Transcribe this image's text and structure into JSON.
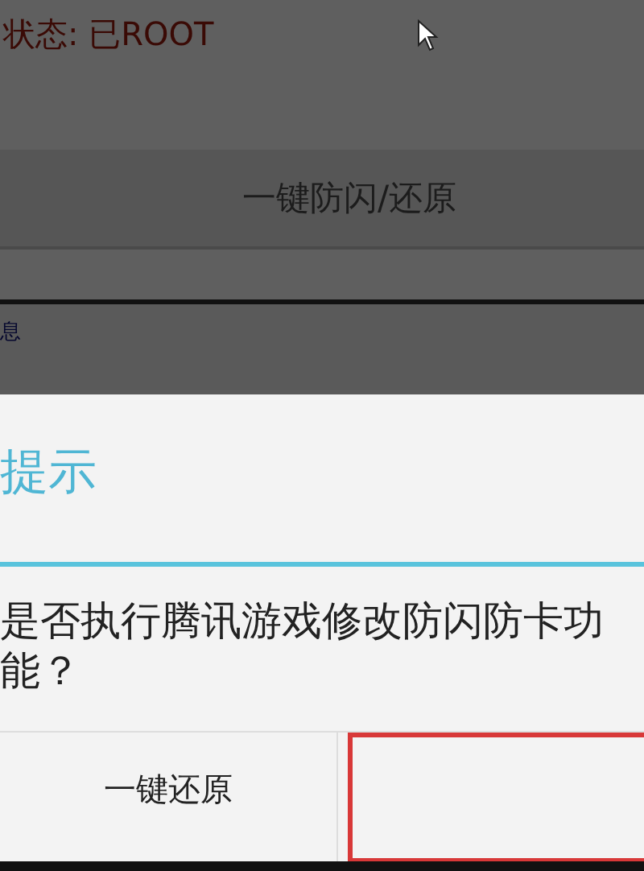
{
  "status": {
    "text": "状态: 已ROOT"
  },
  "main_button": {
    "label": "一键防闪/还原"
  },
  "info_link": {
    "text": "息"
  },
  "dialog": {
    "title": "提示",
    "message": "是否执行腾讯游戏修改防闪防卡功能？",
    "buttons": [
      {
        "label": "一键还原",
        "highlighted": false
      },
      {
        "highlighted": true
      }
    ]
  }
}
